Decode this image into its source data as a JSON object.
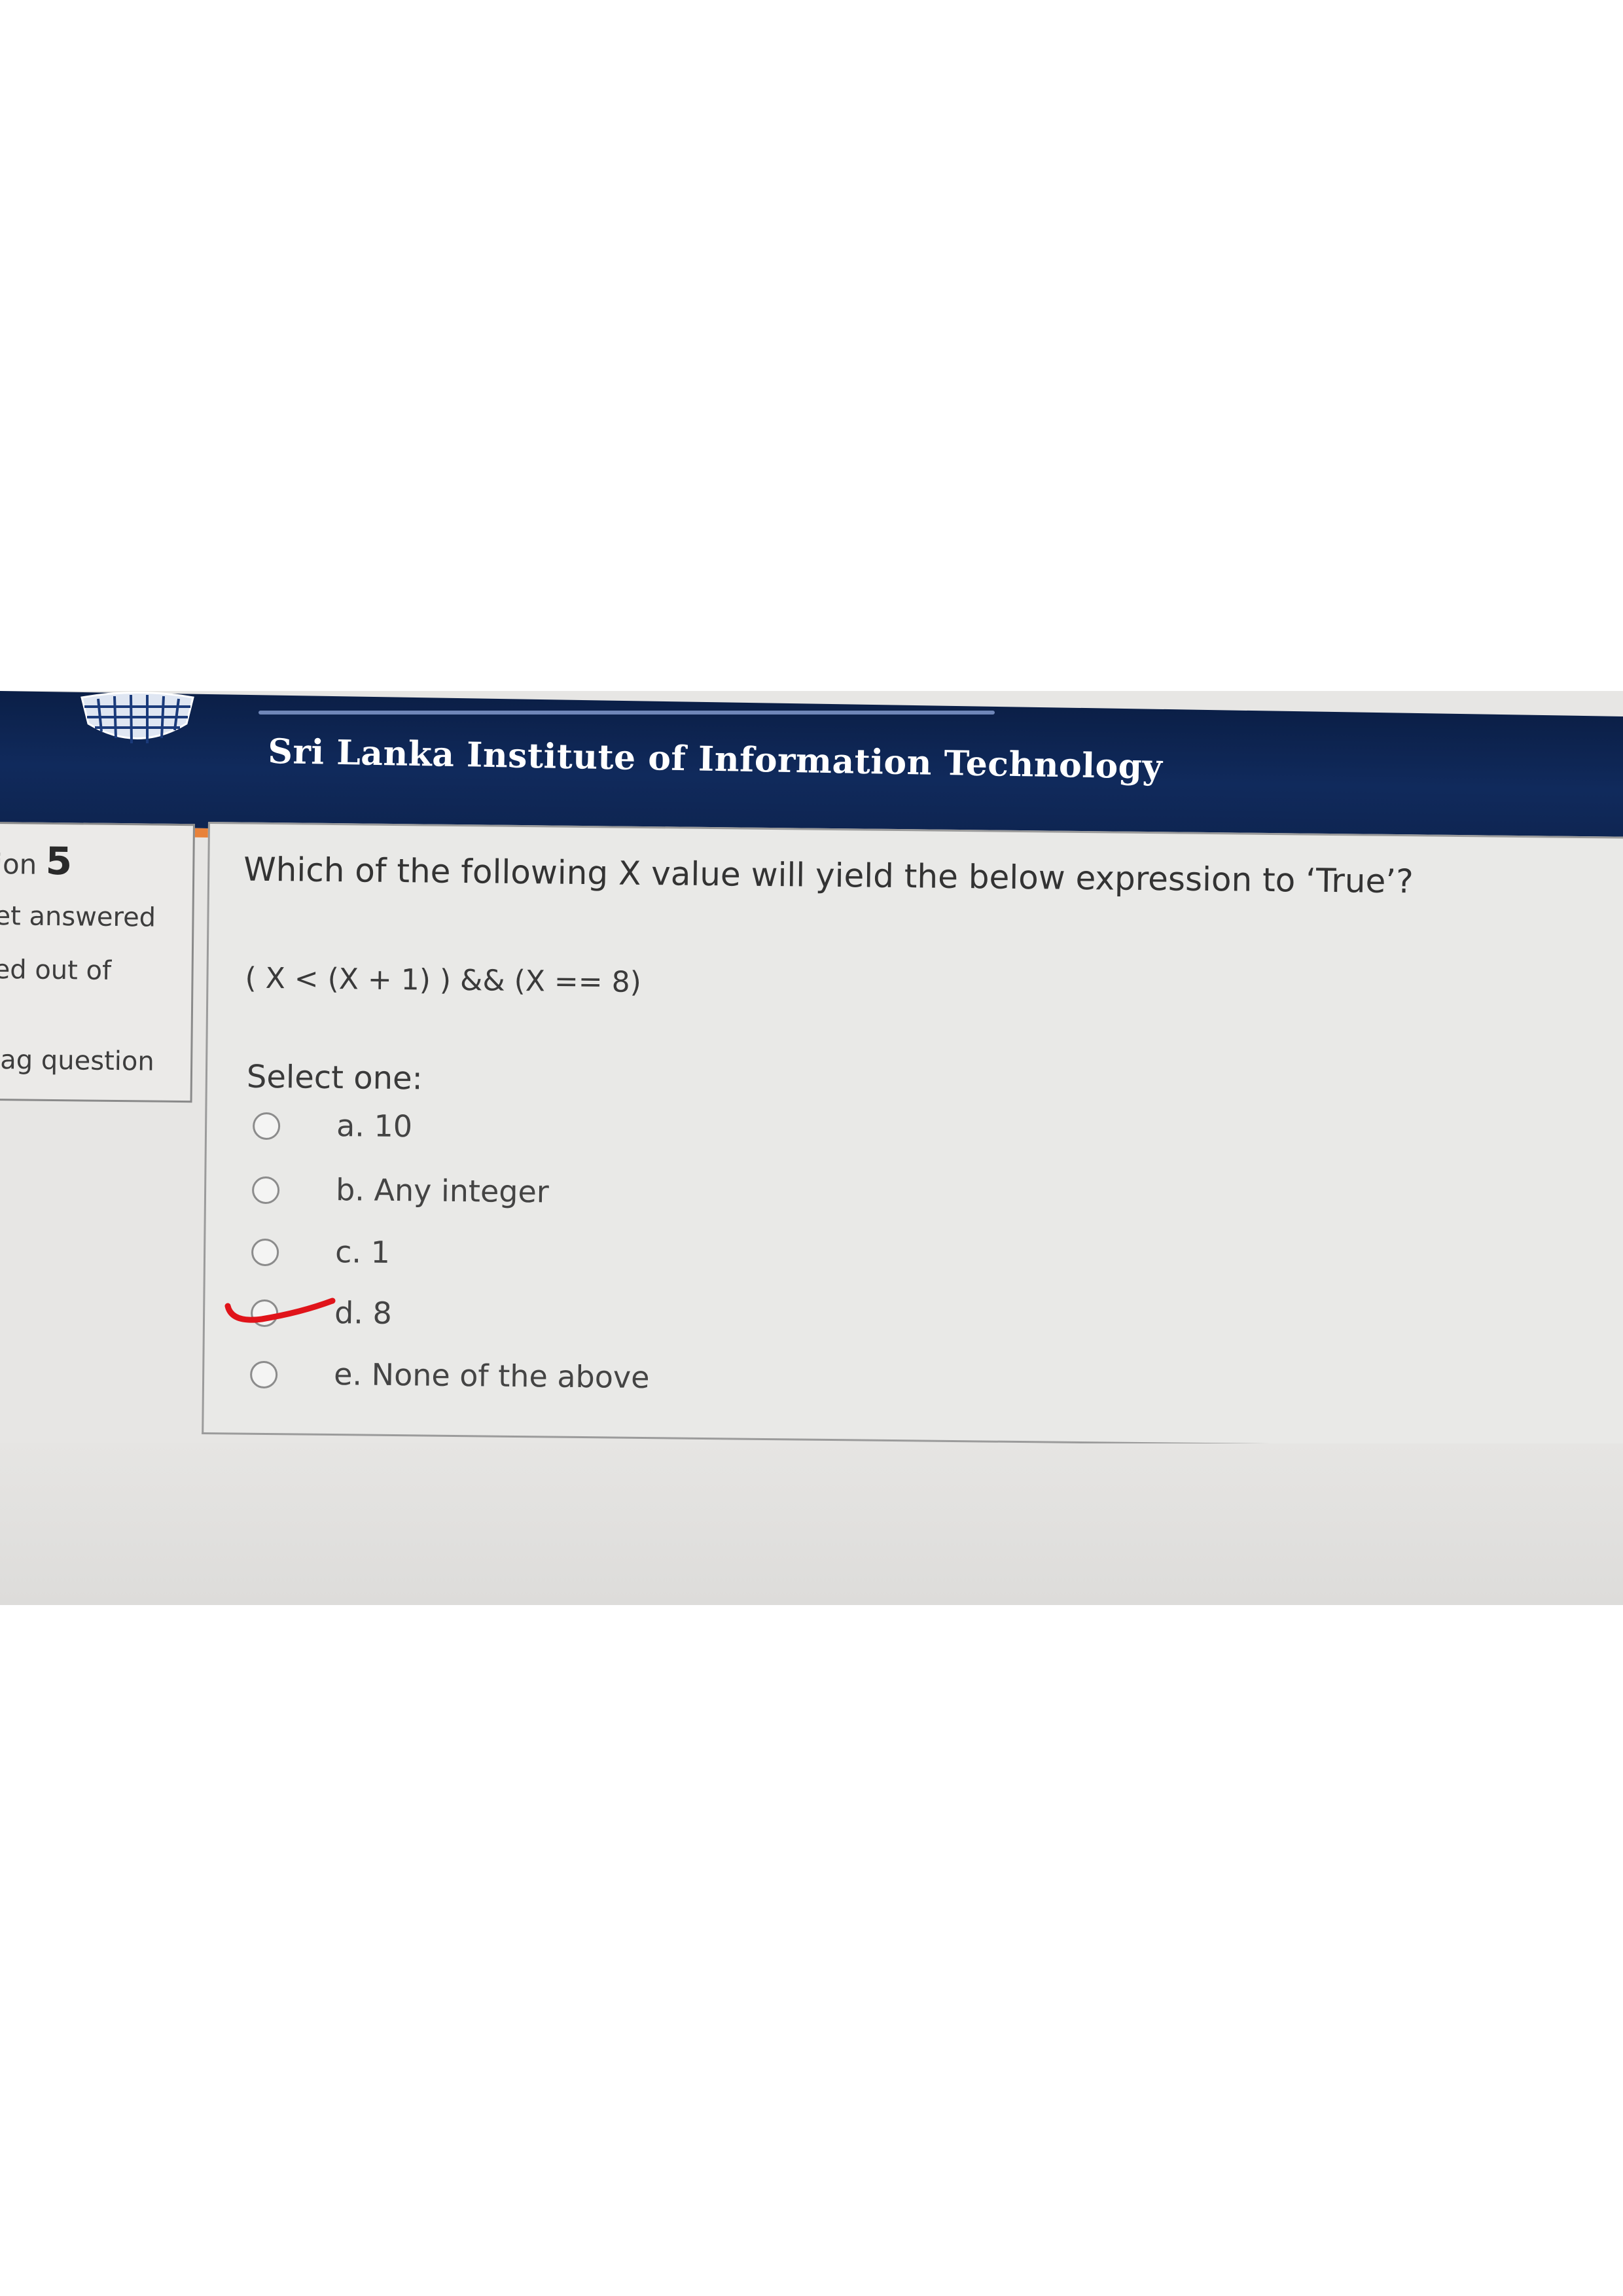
{
  "header": {
    "site_title": "Sri Lanka Institute of Information Technology",
    "logo_icon": "sliit-logo-icon"
  },
  "question_info": {
    "label": "ion",
    "number": "5",
    "status": "et answered",
    "marks": "ed out of",
    "flag_label": "lag question"
  },
  "question": {
    "text": "Which of the following X value will yield the below expression to ‘True’?",
    "expression": "( X < (X + 1) ) && (X == 8)",
    "prompt": "Select one:",
    "options": [
      {
        "label": "a. 10"
      },
      {
        "label": "b. Any integer"
      },
      {
        "label": "c. 1"
      },
      {
        "label": "d. 8"
      },
      {
        "label": "e. None of the above"
      }
    ]
  },
  "colors": {
    "banner": "#0b1f47",
    "stripe": "#e8823a",
    "tick": "#e0141a"
  }
}
